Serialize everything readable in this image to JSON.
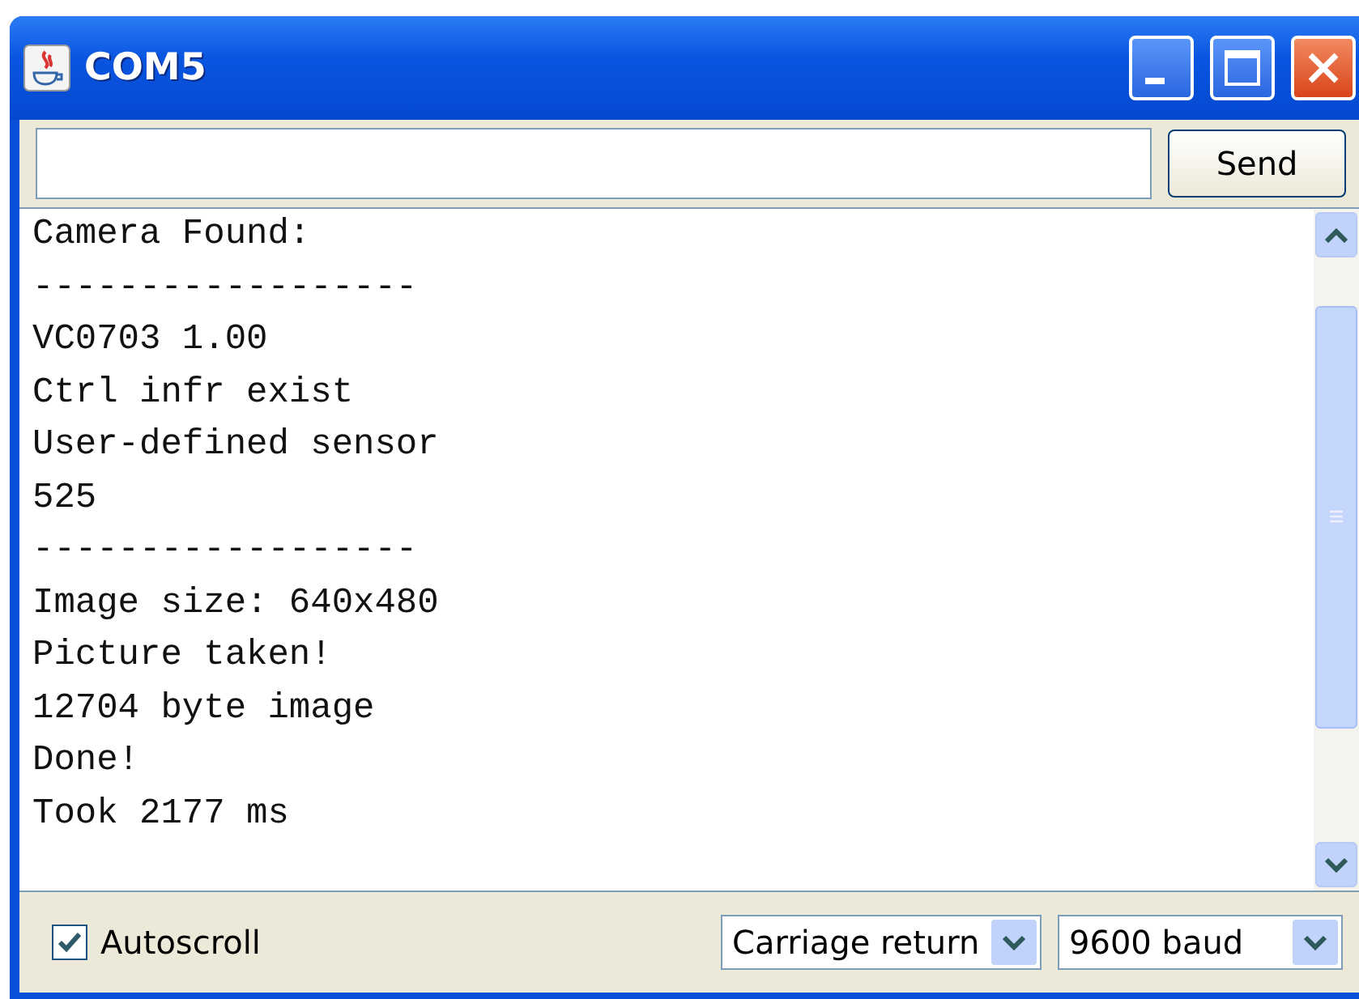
{
  "window": {
    "title": "COM5"
  },
  "send_button": {
    "label": "Send"
  },
  "output_lines": [
    "Camera Found:",
    "------------------",
    "VC0703 1.00",
    "Ctrl infr exist",
    "User-defined sensor",
    "525",
    "------------------",
    "Image size: 640x480",
    "Picture taken!",
    "12704 byte image",
    "Done!",
    "Took 2177 ms"
  ],
  "autoscroll": {
    "label": "Autoscroll",
    "checked": true
  },
  "line_ending": {
    "value": "Carriage return"
  },
  "baud_rate": {
    "value": "9600 baud"
  }
}
